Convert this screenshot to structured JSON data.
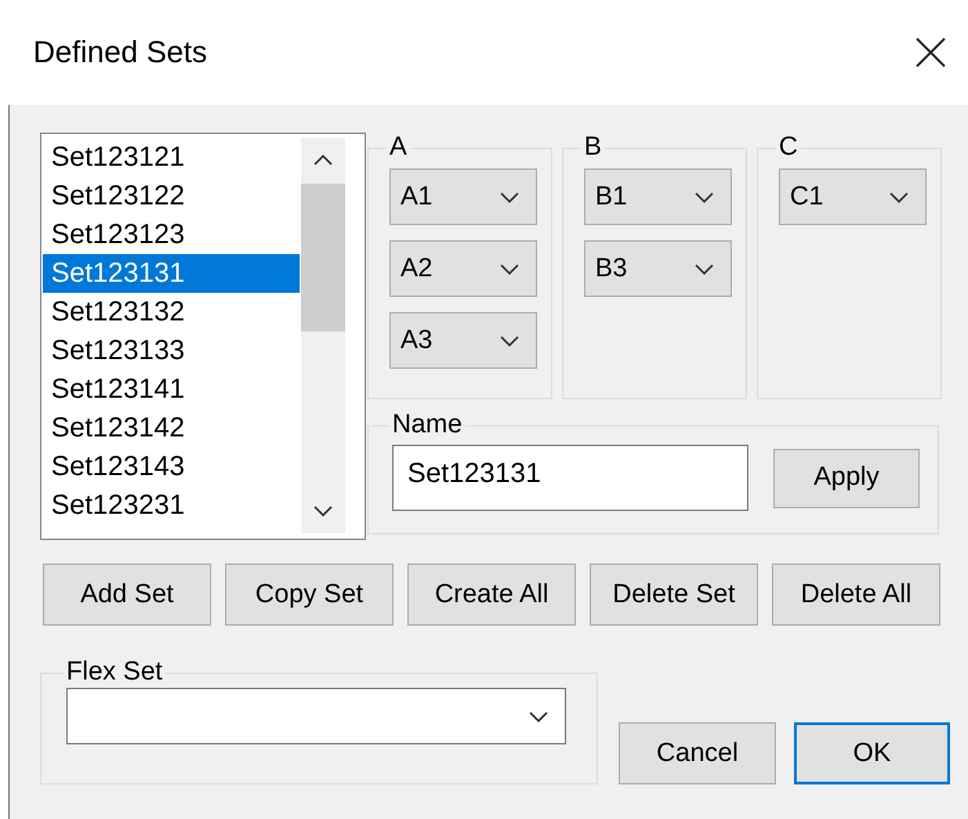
{
  "window": {
    "title": "Defined Sets"
  },
  "sets_list": {
    "items": [
      {
        "label": "Set123121",
        "selected": false
      },
      {
        "label": "Set123122",
        "selected": false
      },
      {
        "label": "Set123123",
        "selected": false
      },
      {
        "label": "Set123131",
        "selected": true
      },
      {
        "label": "Set123132",
        "selected": false
      },
      {
        "label": "Set123133",
        "selected": false
      },
      {
        "label": "Set123141",
        "selected": false
      },
      {
        "label": "Set123142",
        "selected": false
      },
      {
        "label": "Set123143",
        "selected": false
      },
      {
        "label": "Set123231",
        "selected": false
      }
    ]
  },
  "groups": [
    {
      "label": "A",
      "combos": [
        "A1",
        "A2",
        "A3"
      ]
    },
    {
      "label": "B",
      "combos": [
        "B1",
        "B3"
      ]
    },
    {
      "label": "C",
      "combos": [
        "C1"
      ]
    }
  ],
  "name_group": {
    "label": "Name",
    "value": "Set123131",
    "button": "Apply"
  },
  "action_buttons": [
    "Add Set",
    "Copy Set",
    "Create All",
    "Delete Set",
    "Delete All"
  ],
  "flex_set": {
    "label": "Flex Set"
  },
  "dialog_buttons": [
    {
      "label": "Cancel",
      "default": false
    },
    {
      "label": "OK",
      "default": true
    }
  ]
}
